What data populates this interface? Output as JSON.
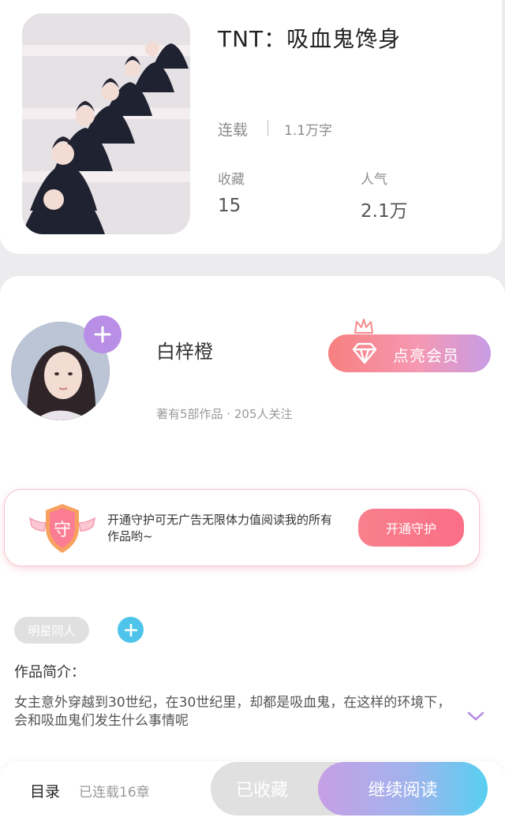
{
  "book": {
    "title": "TNT：吸血鬼馋身",
    "status": "连载",
    "word_count": "1.1万字",
    "stats": [
      {
        "label": "收藏",
        "value": "15"
      },
      {
        "label": "人气",
        "value": "2.1万"
      }
    ]
  },
  "author": {
    "name": "白梓橙",
    "meta": "著有5部作品 · 205人关注",
    "follow_icon": "plus-icon"
  },
  "vip": {
    "label": "点亮会员",
    "icon": "diamond-icon",
    "badge_icon": "crown-icon"
  },
  "guard": {
    "badge_char": "守",
    "text": "开通守护可无广告无限体力值阅读我的所有作品哟~",
    "button_label": "开通守护"
  },
  "tags": {
    "items": [
      "明星同人"
    ],
    "add_icon": "plus-icon"
  },
  "intro": {
    "heading": "作品简介：",
    "text": "女主意外穿越到30世纪，在30世纪里，却都是吸血鬼，在这样的环境下，会和吸血鬼们发生什么事情呢",
    "expand_icon": "chevron-down-icon"
  },
  "bottom_bar": {
    "catalog_label": "目录",
    "chapter_count": "已连载16章",
    "collected_label": "已收藏",
    "read_label": "继续阅读"
  },
  "colors": {
    "purple_accent": "#b88ee6",
    "pink_accent": "#fb6f86",
    "blue_accent": "#4fc4ea",
    "gray_button": "#e0e0e0"
  }
}
